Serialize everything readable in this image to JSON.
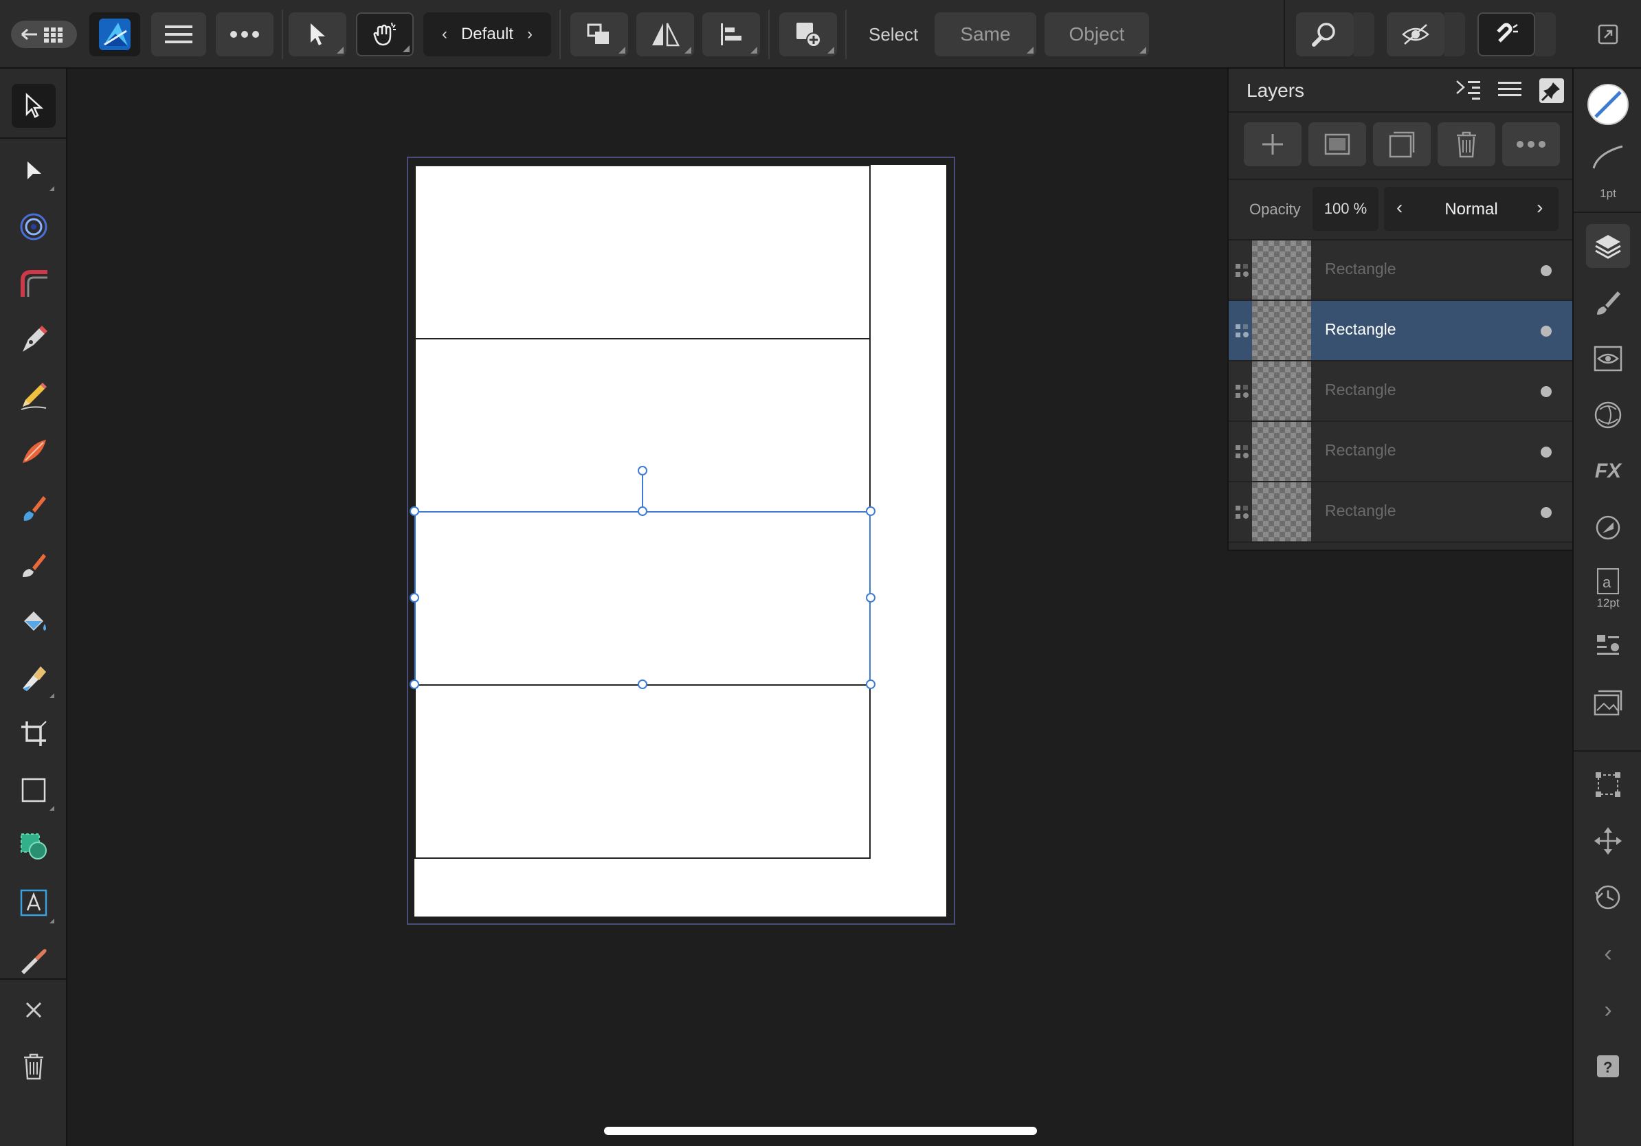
{
  "topbar": {
    "persona_label": "Default",
    "select_label": "Select",
    "same_label": "Same",
    "object_label": "Object"
  },
  "layers_panel": {
    "title": "Layers",
    "opacity_label": "Opacity",
    "opacity_value": "100 %",
    "blend_mode": "Normal",
    "rows": [
      {
        "name": "Rectangle",
        "selected": false
      },
      {
        "name": "Rectangle",
        "selected": true
      },
      {
        "name": "Rectangle",
        "selected": false
      },
      {
        "name": "Rectangle",
        "selected": false
      },
      {
        "name": "Rectangle",
        "selected": false
      }
    ]
  },
  "studio": {
    "stroke_width": "1pt",
    "font_size": "12pt"
  },
  "colors": {
    "accent": "#3e7bd3",
    "selected_row": "#385171",
    "background": "#1e1e1e",
    "panel": "#2b2b2b"
  },
  "icons": {
    "top": [
      "back-grid-icon",
      "app-logo-icon",
      "menu-icon",
      "more-icon",
      "move-tool-icon",
      "gesture-icon",
      "arrange-icon",
      "flip-icon",
      "align-icon",
      "insert-icon",
      "zoom-icon",
      "view-mode-icon",
      "snapping-icon",
      "fullscreen-icon"
    ],
    "left": [
      "move-tool-icon",
      "node-tool-icon",
      "contour-tool-icon",
      "corner-tool-icon",
      "pen-tool-icon",
      "pencil-tool-icon",
      "vector-brush-icon",
      "paint-brush-icon",
      "eraser-brush-icon",
      "fill-tool-icon",
      "transparency-tool-icon",
      "crop-tool-icon",
      "rectangle-tool-icon",
      "shape-builder-icon",
      "text-tool-icon",
      "color-picker-icon",
      "close-icon",
      "trash-icon"
    ],
    "right": [
      "color-icon",
      "stroke-icon",
      "layers-icon",
      "brushes-icon",
      "appearance-icon",
      "adjustments-icon",
      "fx-icon",
      "transparency-icon",
      "text-style-icon",
      "text-panel-icon",
      "stock-icon",
      "transform-icon",
      "navigator-icon",
      "history-icon",
      "chevron-left-icon",
      "chevron-right-icon",
      "help-icon"
    ]
  }
}
